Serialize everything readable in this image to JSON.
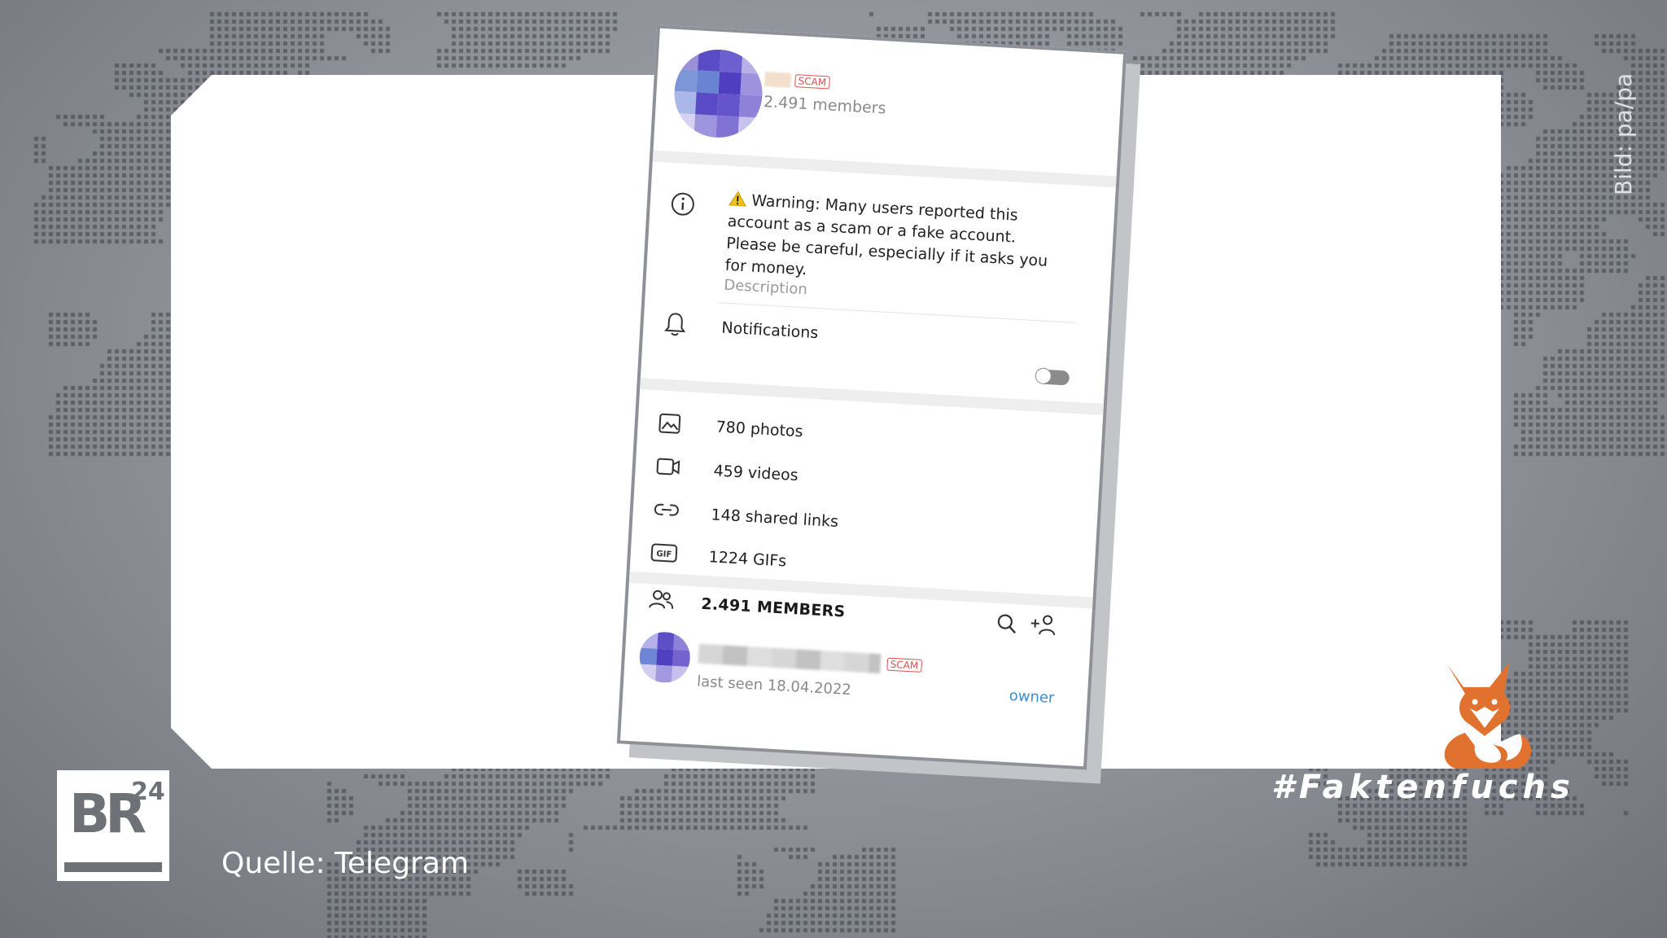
{
  "profile": {
    "scam_badge": "SCAM",
    "members_count": "2.491 members"
  },
  "info": {
    "warning_text": "Warning: Many users reported this account as a scam or a fake account. Please be careful, especially if it asks you for money.",
    "description_label": "Description"
  },
  "notifications": {
    "label": "Notifications",
    "enabled": false
  },
  "media": [
    {
      "icon": "photo-icon",
      "label": "780 photos"
    },
    {
      "icon": "video-icon",
      "label": "459 videos"
    },
    {
      "icon": "link-icon",
      "label": "148 shared links"
    },
    {
      "icon": "gif-icon",
      "label": "1224 GIFs"
    }
  ],
  "members": {
    "heading": "2.491 MEMBERS",
    "list": [
      {
        "scam_badge": "SCAM",
        "last_seen": "last seen 18.04.2022",
        "role": "owner"
      }
    ]
  },
  "overlay": {
    "source": "Quelle: Telegram",
    "credit": "Bild: pa/pa",
    "hashtag": "#Faktenfuchs",
    "logo_br": "BR",
    "logo_num": "24"
  },
  "colors": {
    "scam_red": "#d9534f",
    "owner_blue": "#3a8fcf",
    "fox_orange": "#e0712f"
  }
}
